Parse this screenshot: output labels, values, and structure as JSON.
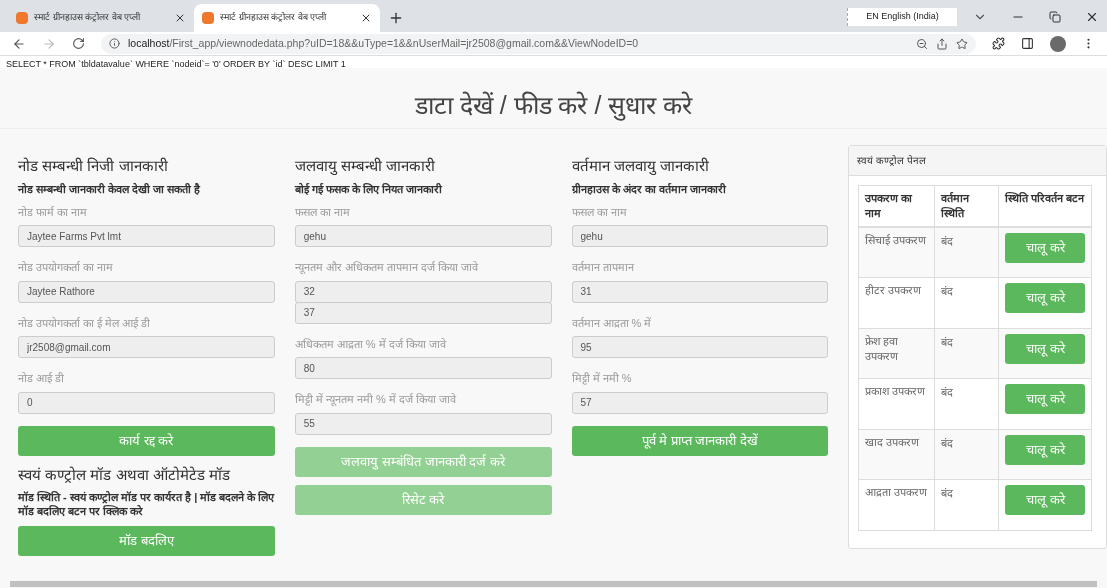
{
  "browser": {
    "tabs": [
      {
        "title": "स्मार्ट ग्रीनहाउस कंट्रोलर वेब एप्ली",
        "selected": false
      },
      {
        "title": "स्मार्ट ग्रीनहाउस कंट्रोलर वेब एप्ली",
        "selected": true
      }
    ],
    "language": "EN English (India)",
    "address": {
      "host": "localhost",
      "path": "/First_app/viewnodedata.php?uID=18&&uType=1&&nUserMail=jr2508@gmail.com&&ViewNodeID=0"
    }
  },
  "query_text": "SELECT * FROM `tbldatavalue` WHERE `nodeid`= '0' ORDER BY `id` DESC LIMIT 1",
  "page_title": "डाटा देखें / फीड करे / सुधार करे",
  "columns": [
    {
      "items": [
        {
          "kind": "heading",
          "text": "नोड सम्बन्धी निजी जानकारी"
        },
        {
          "kind": "note",
          "text": "नोड सम्बन्धी जानकारी केवल देखी जा सकती है"
        },
        {
          "kind": "label",
          "text": "नोड फार्म का नाम"
        },
        {
          "kind": "field",
          "text": "Jaytee Farms Pvt lmt"
        },
        {
          "kind": "label",
          "text": "नोड उपयोगकर्ता का नाम"
        },
        {
          "kind": "field",
          "text": "Jaytee Rathore"
        },
        {
          "kind": "label",
          "text": "नोड उपयोगकर्ता का ई मेल आई डी"
        },
        {
          "kind": "field",
          "text": "jr2508@gmail.com"
        },
        {
          "kind": "label",
          "text": "नोड आई डी"
        },
        {
          "kind": "field",
          "text": "0"
        },
        {
          "kind": "button",
          "text": "कार्य रद्द करे",
          "disabled": false
        },
        {
          "kind": "heading",
          "text": "स्वयं कण्ट्रोल मॉड अथवा ऑटोमेटेड मॉड"
        },
        {
          "kind": "note",
          "text": "मॉड स्थिति - स्वयं कण्ट्रोल मॉड पर कार्यरत है | मॉड बदलने के लिए मॉड बदलिए बटन पर क्लिक करे"
        },
        {
          "kind": "button",
          "text": "मॉड बदलिए",
          "disabled": false
        }
      ]
    },
    {
      "items": [
        {
          "kind": "heading",
          "text": "जलवायु सम्बन्धी जानकारी"
        },
        {
          "kind": "note",
          "text": "बोई गई फसक के लिए नियत जानकारी"
        },
        {
          "kind": "label",
          "text": "फसल का नाम"
        },
        {
          "kind": "field",
          "text": "gehu"
        },
        {
          "kind": "label",
          "text": "न्यूनतम और अधिकतम तापमान दर्ज किया जावे"
        },
        {
          "kind": "field",
          "text": "32"
        },
        {
          "kind": "stacked_field",
          "text": "37"
        },
        {
          "kind": "label",
          "text": "अधिकतम आद्रता % में दर्ज किया जावे"
        },
        {
          "kind": "field",
          "text": "80"
        },
        {
          "kind": "label",
          "text": "मिट्टी में न्यूनतम नमी % में दर्ज किया जावे"
        },
        {
          "kind": "field",
          "text": "55"
        },
        {
          "kind": "button",
          "text": "जलवायु सम्बंधित जानकारी दर्ज करे",
          "disabled": true
        },
        {
          "kind": "button",
          "text": "रिसेट करे",
          "disabled": true
        }
      ]
    },
    {
      "items": [
        {
          "kind": "heading",
          "text": "वर्तमान जलवायु जानकारी"
        },
        {
          "kind": "note",
          "text": "ग्रीनहाउस के अंदर का वर्तमान जानकारी"
        },
        {
          "kind": "label",
          "text": "फसल का नाम"
        },
        {
          "kind": "field",
          "text": "gehu"
        },
        {
          "kind": "label",
          "text": "वर्तमान तापमान"
        },
        {
          "kind": "field",
          "text": "31"
        },
        {
          "kind": "label",
          "text": "वर्तमान आद्रता % में"
        },
        {
          "kind": "field",
          "text": "95"
        },
        {
          "kind": "label",
          "text": "मिट्टी में नमी %"
        },
        {
          "kind": "field",
          "text": "57"
        },
        {
          "kind": "button",
          "text": "पूर्व मे प्राप्त जानकारी देखें",
          "disabled": false
        }
      ]
    }
  ],
  "control_panel": {
    "title": "स्वयं कण्ट्रोल पेनल",
    "columns": [
      "उपकरण का नाम",
      "वर्तमान स्थिति",
      "स्थिति परिवर्तन बटन"
    ],
    "rows": [
      {
        "device": "सिचाई उपकरण",
        "status": "बंद",
        "action": "चालू करे"
      },
      {
        "device": "हीटर उपकरण",
        "status": "बंद",
        "action": "चालू करे"
      },
      {
        "device": "फ्रेश हवा उपकरण",
        "status": "बंद",
        "action": "चालू करे"
      },
      {
        "device": "प्रकाश उपकरण",
        "status": "बंद",
        "action": "चालू करे"
      },
      {
        "device": "खाद उपकरण",
        "status": "बंद",
        "action": "चालू करे"
      },
      {
        "device": "आद्रता उपकरण",
        "status": "बंद",
        "action": "चालू करे"
      }
    ]
  }
}
